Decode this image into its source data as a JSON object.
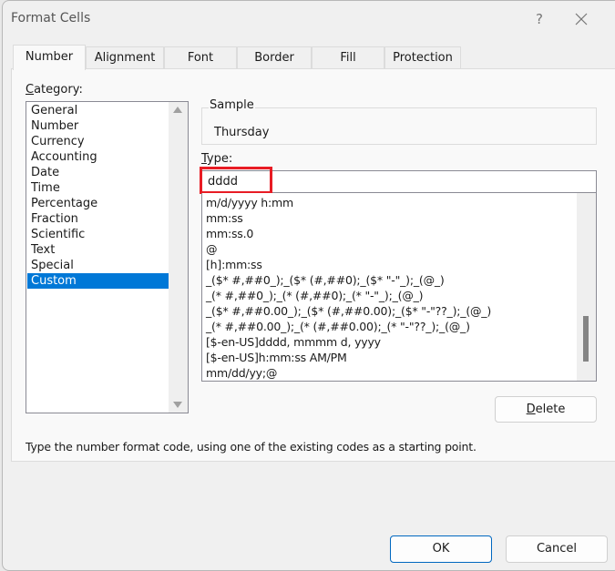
{
  "window": {
    "title": "Format Cells",
    "help_label": "?",
    "close_icon": "close-icon"
  },
  "tabs": [
    {
      "label": "Number",
      "active": true
    },
    {
      "label": "Alignment",
      "active": false
    },
    {
      "label": "Font",
      "active": false
    },
    {
      "label": "Border",
      "active": false
    },
    {
      "label": "Fill",
      "active": false
    },
    {
      "label": "Protection",
      "active": false
    }
  ],
  "category": {
    "label_mnemonic": "C",
    "label_rest": "ategory:",
    "items": [
      "General",
      "Number",
      "Currency",
      "Accounting",
      "Date",
      "Time",
      "Percentage",
      "Fraction",
      "Scientific",
      "Text",
      "Special",
      "Custom"
    ],
    "selected": "Custom"
  },
  "sample": {
    "legend": "Sample",
    "value": "Thursday"
  },
  "type": {
    "label_mnemonic": "T",
    "label_rest": "ype:",
    "value": "dddd"
  },
  "format_codes": [
    "m/d/yyyy h:mm",
    "mm:ss",
    "mm:ss.0",
    "@",
    "[h]:mm:ss",
    "_($* #,##0_);_($* (#,##0);_($* \"-\"_);_(@_)",
    "_(* #,##0_);_(* (#,##0);_(* \"-\"_);_(@_)",
    "_($* #,##0.00_);_($* (#,##0.00);_($* \"-\"??_);_(@_)",
    "_(* #,##0.00_);_(* (#,##0.00);_(* \"-\"??_);_(@_)",
    "[$-en-US]dddd, mmmm d, yyyy",
    "[$-en-US]h:mm:ss AM/PM",
    "mm/dd/yy;@"
  ],
  "buttons": {
    "delete_mnemonic": "D",
    "delete_rest": "elete",
    "ok": "OK",
    "cancel": "Cancel"
  },
  "hint": "Type the number format code, using one of the existing codes as a starting point.",
  "colors": {
    "accent": "#0078d7",
    "highlight_box": "#e81c24",
    "ok_border": "#0067c0"
  }
}
